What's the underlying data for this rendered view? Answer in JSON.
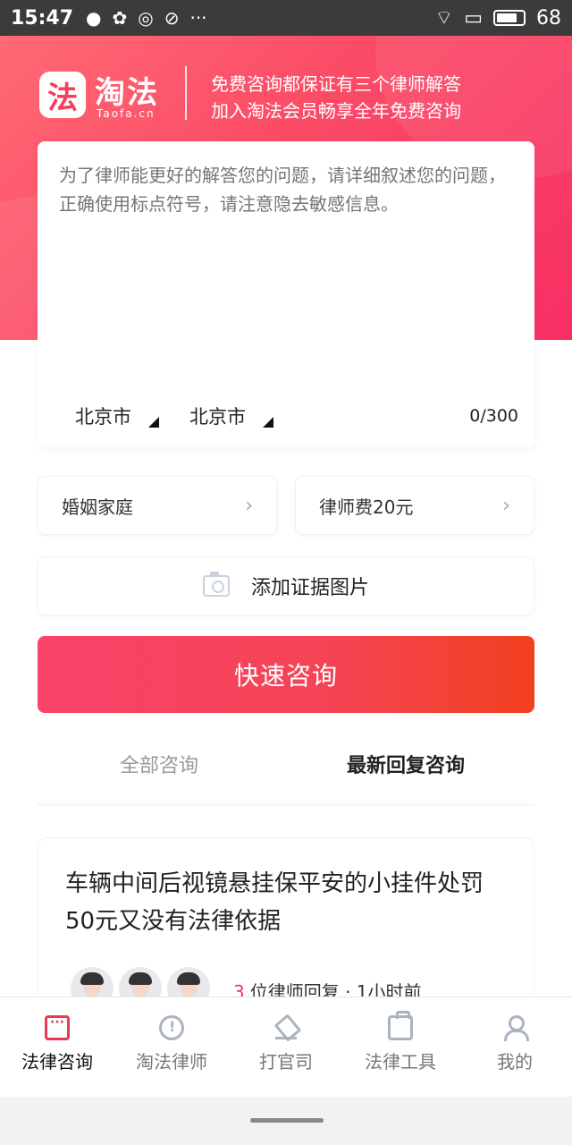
{
  "status": {
    "time": "15:47",
    "battery": "68"
  },
  "brand": {
    "logo_char": "法",
    "name": "淘法",
    "domain": "Taofa.cn"
  },
  "hero": {
    "slogan_1": "免费咨询都保证有三个律师解答",
    "slogan_2": "加入淘法会员畅享全年免费咨询"
  },
  "question": {
    "placeholder": "为了律师能更好的解答您的问题，请详细叙述您的问题，正确使用标点符号，请注意隐去敏感信息。",
    "city_1": "北京市",
    "city_2": "北京市",
    "counter": "0/300"
  },
  "options": {
    "category": "婚姻家庭",
    "fee": "律师费20元",
    "evidence": "添加证据图片"
  },
  "submit_label": "快速咨询",
  "tabs": {
    "all": "全部咨询",
    "latest": "最新回复咨询"
  },
  "post": {
    "title": "车辆中间后视镜悬挂保平安的小挂件处罚50元又没有法律依据",
    "reply_count": "3",
    "reply_text": "位律师回复 · 1小时前"
  },
  "nav": [
    {
      "label": "法律咨询",
      "icon": "chat-icon"
    },
    {
      "label": "淘法律师",
      "icon": "lawyer-icon"
    },
    {
      "label": "打官司",
      "icon": "gavel-icon"
    },
    {
      "label": "法律工具",
      "icon": "toolbox-icon"
    },
    {
      "label": "我的",
      "icon": "user-icon"
    }
  ],
  "colors": {
    "accent": "#f53e5d",
    "button_end": "#f2401d"
  }
}
